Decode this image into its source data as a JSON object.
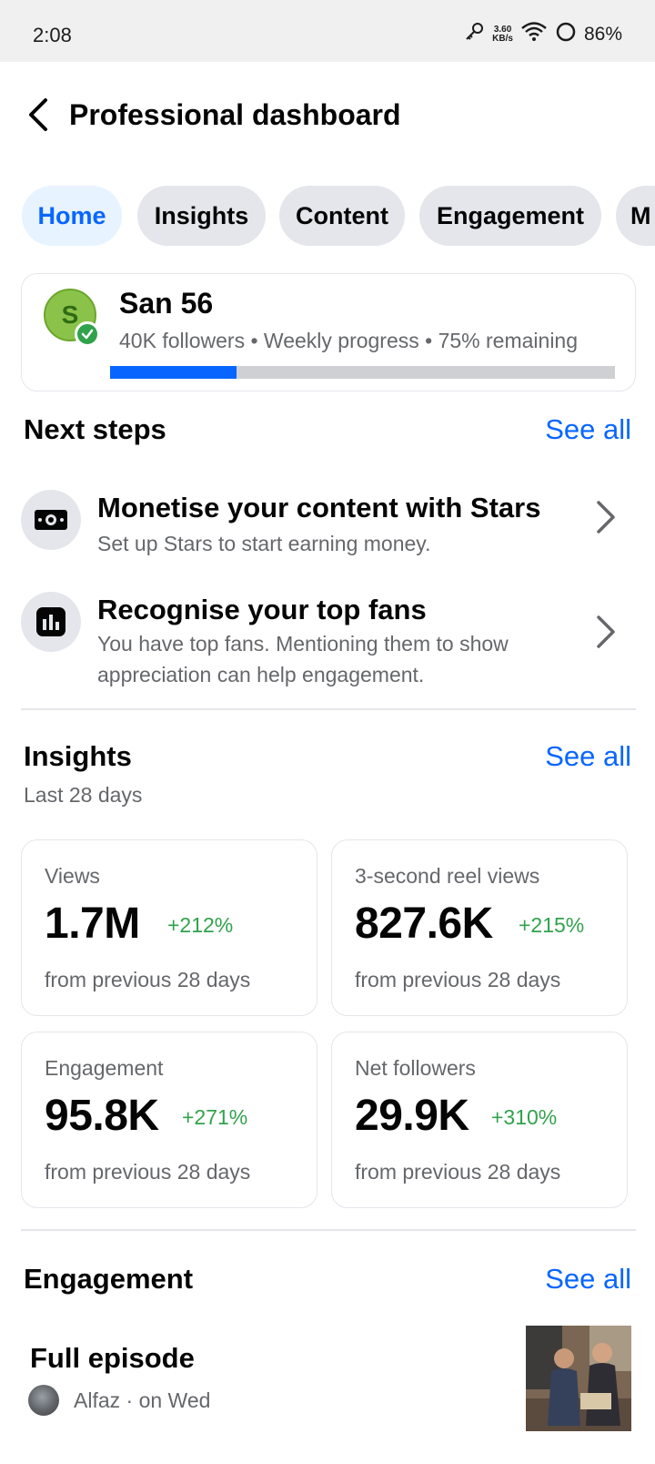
{
  "status_bar": {
    "time": "2:08",
    "speed_value": "3.60",
    "speed_unit": "KB/s",
    "battery": "86%"
  },
  "header": {
    "title": "Professional dashboard"
  },
  "tabs": [
    {
      "label": "Home",
      "active": true
    },
    {
      "label": "Insights",
      "active": false
    },
    {
      "label": "Content",
      "active": false
    },
    {
      "label": "Engagement",
      "active": false
    },
    {
      "label": "M",
      "active": false
    }
  ],
  "profile": {
    "avatar_letter": "S",
    "name": "San 56",
    "meta": "40K followers • Weekly progress • 75% remaining",
    "progress_fraction": 0.25
  },
  "next_steps": {
    "title": "Next steps",
    "see_all": "See all",
    "items": [
      {
        "title": "Monetise your content with Stars",
        "subtitle": "Set up Stars to start earning money.",
        "icon": "money-icon"
      },
      {
        "title": "Recognise your top fans",
        "subtitle": "You have top fans. Mentioning them to show appreciation can help engagement.",
        "icon": "bar-chart-icon"
      }
    ]
  },
  "insights": {
    "title": "Insights",
    "see_all": "See all",
    "period": "Last 28 days",
    "metrics": [
      {
        "label": "Views",
        "value": "1.7M",
        "change": "+212%",
        "footer": "from previous 28 days"
      },
      {
        "label": "3-second reel views",
        "value": "827.6K",
        "change": "+215%",
        "footer": "from previous 28 days"
      },
      {
        "label": "Engagement",
        "value": "95.8K",
        "change": "+271%",
        "footer": "from previous 28 days"
      },
      {
        "label": "Net followers",
        "value": "29.9K",
        "change": "+310%",
        "footer": "from previous 28 days"
      }
    ]
  },
  "engagement": {
    "title": "Engagement",
    "see_all": "See all",
    "post": {
      "title": "Full episode",
      "meta": "Alfaz · on Wed"
    }
  },
  "colors": {
    "accent": "#0866ff",
    "positive": "#31a24c",
    "secondary_text": "#65676b"
  }
}
